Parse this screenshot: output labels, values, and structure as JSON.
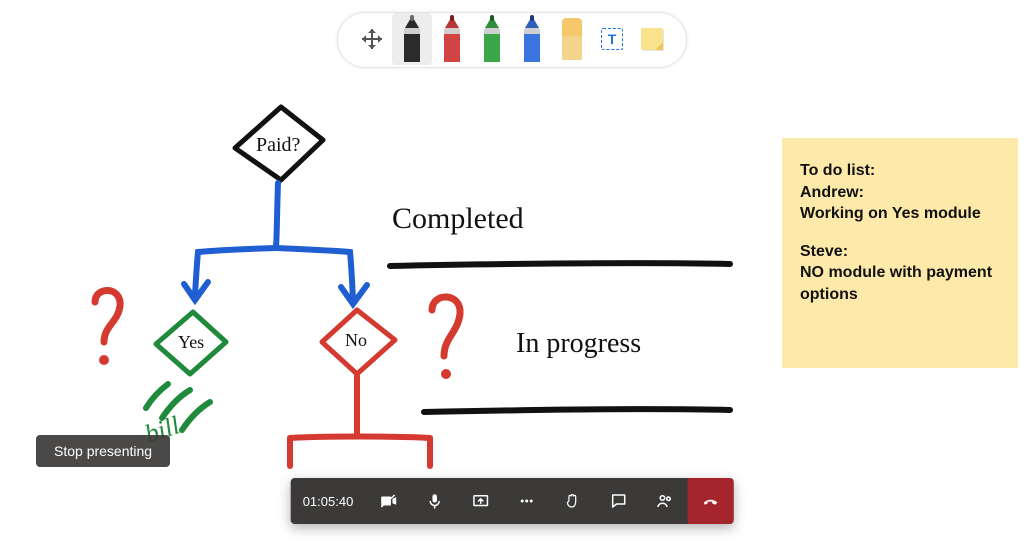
{
  "toolbar": {
    "tools": {
      "move": "move-handle",
      "pen_black": "pen-black",
      "pen_red": "pen-red",
      "pen_green": "pen-green",
      "pen_blue": "pen-blue",
      "eraser": "eraser",
      "text": "text-box",
      "note": "sticky-note"
    },
    "text_tool_glyph": "T",
    "selected": "pen_black"
  },
  "whiteboard": {
    "labels": {
      "decision": "Paid?",
      "branch_yes": "Yes",
      "branch_no": "No",
      "bill": "bill"
    },
    "headings": {
      "completed": "Completed",
      "in_progress": "In progress"
    },
    "ink_colors": {
      "black": "#111111",
      "red": "#d43a2f",
      "green": "#1f8a3b",
      "blue": "#1f5fd1"
    }
  },
  "sticky_note": {
    "lines": [
      "To do list:",
      "Andrew:",
      "Working on Yes module",
      "",
      "Steve:",
      "NO module with payment options"
    ]
  },
  "stop_presenting_label": "Stop presenting",
  "call_bar": {
    "timer": "01:05:40",
    "buttons": {
      "camera": "camera-off",
      "mic": "mic",
      "share": "share",
      "more": "more-actions",
      "raise_hand": "raise-hand",
      "chat": "chat",
      "people": "people",
      "hangup": "hang-up"
    }
  }
}
